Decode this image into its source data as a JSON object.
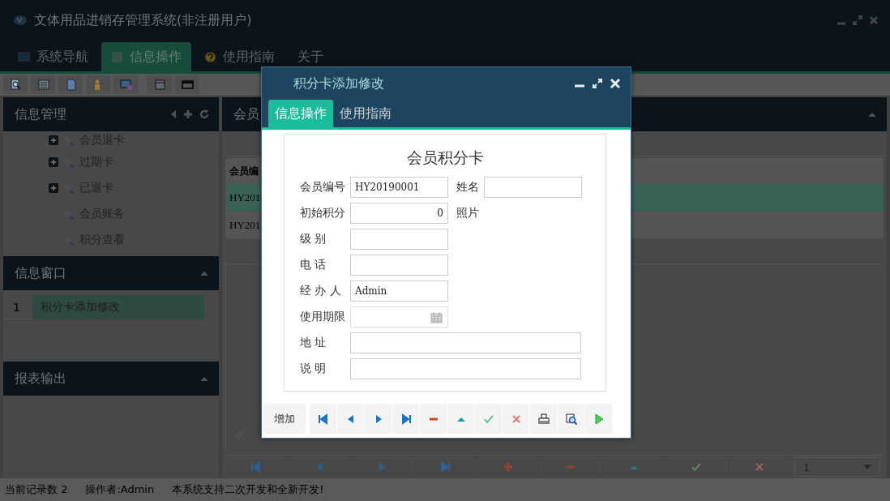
{
  "window": {
    "title": "文体用品进销存管理系统(非注册用户)"
  },
  "main_tabs": [
    {
      "label": "系统导航",
      "selected": false,
      "kind": "monitor"
    },
    {
      "label": "信息操作",
      "selected": true,
      "kind": "grid"
    },
    {
      "label": "使用指南",
      "selected": false,
      "kind": "help"
    },
    {
      "label": "关于",
      "selected": false,
      "kind": "plain"
    }
  ],
  "info_panel": {
    "title": "信息管理",
    "tree": [
      {
        "label": "会员退卡",
        "expandable": true
      },
      {
        "label": "过期卡",
        "expandable": true
      },
      {
        "label": "已退卡",
        "expandable": true
      },
      {
        "label": "会员账务",
        "expandable": false
      },
      {
        "label": "积分查看",
        "expandable": false
      }
    ]
  },
  "window_panel": {
    "title": "信息窗口",
    "rows": [
      {
        "index": "1",
        "label": "积分卡添加修改",
        "selected": true
      }
    ]
  },
  "report_panel": {
    "title": "报表输出"
  },
  "grid": {
    "panel_title": "会员",
    "columns": [
      "会员编"
    ],
    "rows": [
      {
        "cells": [
          "HY201"
        ],
        "selected": true
      },
      {
        "cells": [
          "HY201"
        ],
        "selected": false
      }
    ],
    "page_select": "1"
  },
  "status_bar": [
    "当前记录数 2",
    "操作者:Admin",
    "本系统支持二次开发和全新开发!"
  ],
  "dialog": {
    "title": "积分卡添加修改",
    "tabs": [
      {
        "label": "信息操作",
        "selected": true
      },
      {
        "label": "使用指南",
        "selected": false
      }
    ],
    "heading": "会员积分卡",
    "rows": [
      [
        {
          "label": "会员编号",
          "kind": "text",
          "value": "HY20190001"
        },
        {
          "label": "姓名",
          "kind": "text"
        }
      ],
      [
        {
          "label": "初始积分",
          "kind": "number",
          "value": "0"
        },
        {
          "label": "照片",
          "kind": "label"
        }
      ],
      [
        {
          "label": "级 别",
          "kind": "text"
        }
      ],
      [
        {
          "label": "电 话",
          "kind": "text"
        }
      ],
      [
        {
          "label": "经 办 人",
          "kind": "text",
          "value": "Admin"
        }
      ],
      [
        {
          "label": "使用期限",
          "kind": "date"
        }
      ],
      [
        {
          "label": "地 址",
          "kind": "wide"
        }
      ],
      [
        {
          "label": "说 明",
          "kind": "wide"
        }
      ]
    ],
    "buttons": [
      {
        "kind": "text",
        "label": "增加"
      },
      {
        "kind": "first"
      },
      {
        "kind": "prev"
      },
      {
        "kind": "next"
      },
      {
        "kind": "last"
      },
      {
        "kind": "remove"
      },
      {
        "kind": "up"
      },
      {
        "kind": "save"
      },
      {
        "kind": "cancel"
      },
      {
        "kind": "print"
      },
      {
        "kind": "preview"
      },
      {
        "kind": "run"
      }
    ]
  }
}
